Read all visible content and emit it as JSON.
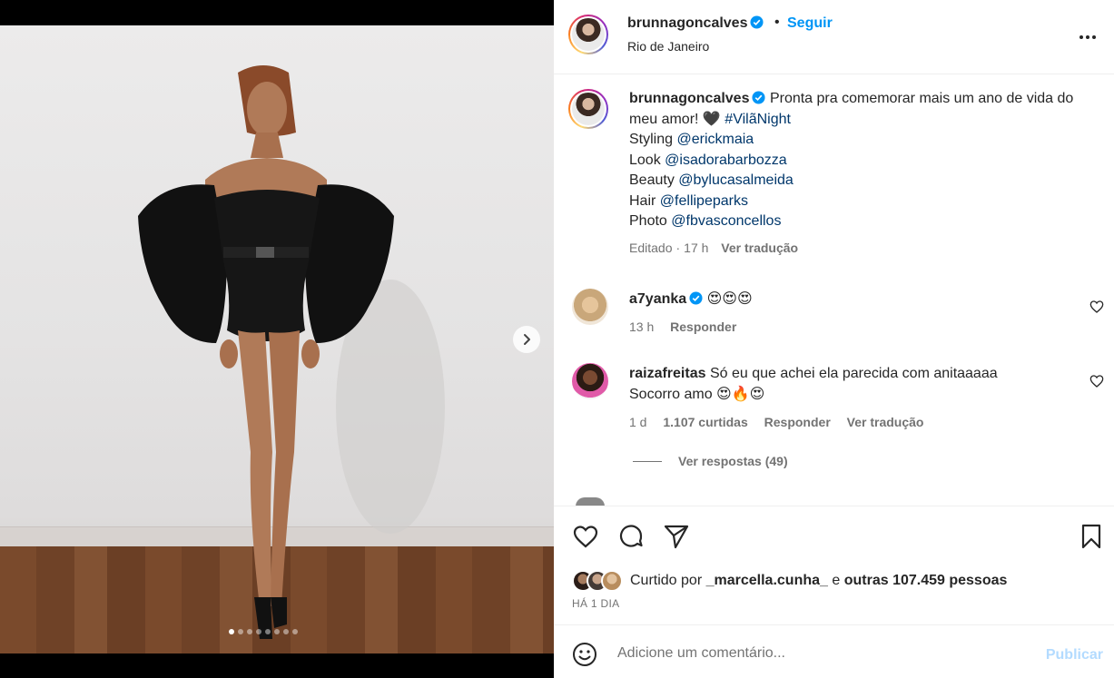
{
  "header": {
    "username": "brunnagoncalves",
    "separator": "•",
    "follow_label": "Seguir",
    "location": "Rio de Janeiro"
  },
  "caption": {
    "username": "brunnagoncalves",
    "text": "Pronta pra comemorar mais um ano de vida do meu amor! 🖤",
    "hashtag": "#VilãNight",
    "credits": [
      {
        "label": "Styling",
        "handle": "@erickmaia"
      },
      {
        "label": "Look",
        "handle": "@isadorabarbozza"
      },
      {
        "label": "Beauty",
        "handle": "@bylucasalmeida"
      },
      {
        "label": "Hair",
        "handle": "@fellipeparks"
      },
      {
        "label": "Photo",
        "handle": "@fbvasconcellos"
      }
    ],
    "edited": "Editado",
    "time": "17 h",
    "translate": "Ver tradução"
  },
  "comments": [
    {
      "username": "a7yanka",
      "text": "😍😍😍",
      "time": "13 h",
      "reply": "Responder"
    },
    {
      "username": "raizafreitas",
      "text": "Só eu que achei ela parecida com anitaaaaa Socorro amo 😍🔥😍",
      "time": "1 d",
      "likes": "1.107 curtidas",
      "reply": "Responder",
      "translate": "Ver tradução",
      "view_replies": "Ver respostas (49)"
    }
  ],
  "likes": {
    "prefix": "Curtido por",
    "user": "_marcella.cunha_",
    "connector": "e",
    "others": "outras 107.459 pessoas"
  },
  "date": "HÁ 1 DIA",
  "add_comment": {
    "placeholder": "Adicione um comentário...",
    "publish_label": "Publicar"
  },
  "carousel": {
    "slide_count": 8,
    "current": 1
  },
  "colors": {
    "link": "#00376b",
    "accent": "#0095f6",
    "muted": "#737373",
    "publish_disabled": "#b3dbff"
  }
}
